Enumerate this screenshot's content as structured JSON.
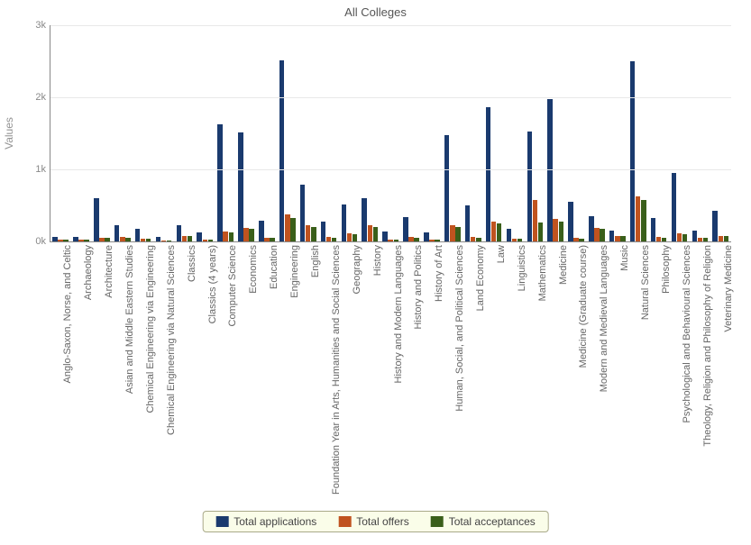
{
  "chart_data": {
    "type": "bar",
    "title": "All Colleges",
    "ylabel": "Values",
    "xlabel": "",
    "ylim": [
      0,
      3000
    ],
    "yticks": [
      0,
      1000,
      2000,
      3000
    ],
    "ytick_labels": [
      "0k",
      "1k",
      "2k",
      "3k"
    ],
    "categories": [
      "Anglo-Saxon, Norse, and Celtic",
      "Archaeology",
      "Architecture",
      "Asian and Middle Eastern Studies",
      "Chemical Engineering via Engineering",
      "Chemical Engineering via Natural Sciences",
      "Classics",
      "Classics (4 years)",
      "Computer Science",
      "Economics",
      "Education",
      "Engineering",
      "English",
      "Foundation Year in Arts, Humanities and Social Sciences",
      "Geography",
      "History",
      "History and Modern Languages",
      "History and Politics",
      "History of Art",
      "Human, Social, and Political Sciences",
      "Land Economy",
      "Law",
      "Linguistics",
      "Mathematics",
      "Medicine",
      "Medicine (Graduate course)",
      "Modern and Medieval Languages",
      "Music",
      "Natural Sciences",
      "Philosophy",
      "Psychological and Behavioural Sciences",
      "Theology, Religion and Philosophy of Religion",
      "Veterinary Medicine"
    ],
    "series": [
      {
        "name": "Total applications",
        "color": "#1a3a6e",
        "values": [
          60,
          60,
          600,
          220,
          170,
          60,
          220,
          120,
          1630,
          1510,
          290,
          2510,
          790,
          280,
          510,
          600,
          140,
          340,
          120,
          1480,
          500,
          1860,
          180,
          1530,
          1980,
          550,
          350,
          150,
          2500,
          320,
          950,
          150,
          420
        ]
      },
      {
        "name": "Total offers",
        "color": "#c0531f",
        "values": [
          30,
          30,
          50,
          60,
          40,
          15,
          80,
          30,
          140,
          190,
          50,
          370,
          220,
          60,
          110,
          230,
          30,
          60,
          30,
          230,
          60,
          270,
          40,
          570,
          310,
          45,
          190,
          80,
          620,
          60,
          110,
          50,
          80
        ]
      },
      {
        "name": "Total acceptances",
        "color": "#3a5f1a",
        "values": [
          25,
          25,
          45,
          50,
          35,
          12,
          70,
          25,
          120,
          170,
          45,
          320,
          200,
          50,
          100,
          200,
          25,
          55,
          25,
          200,
          55,
          250,
          35,
          260,
          280,
          40,
          170,
          70,
          580,
          55,
          100,
          45,
          70
        ]
      }
    ],
    "legend": {
      "position": "bottom",
      "items": [
        "Total applications",
        "Total offers",
        "Total acceptances"
      ]
    },
    "grid": true
  }
}
